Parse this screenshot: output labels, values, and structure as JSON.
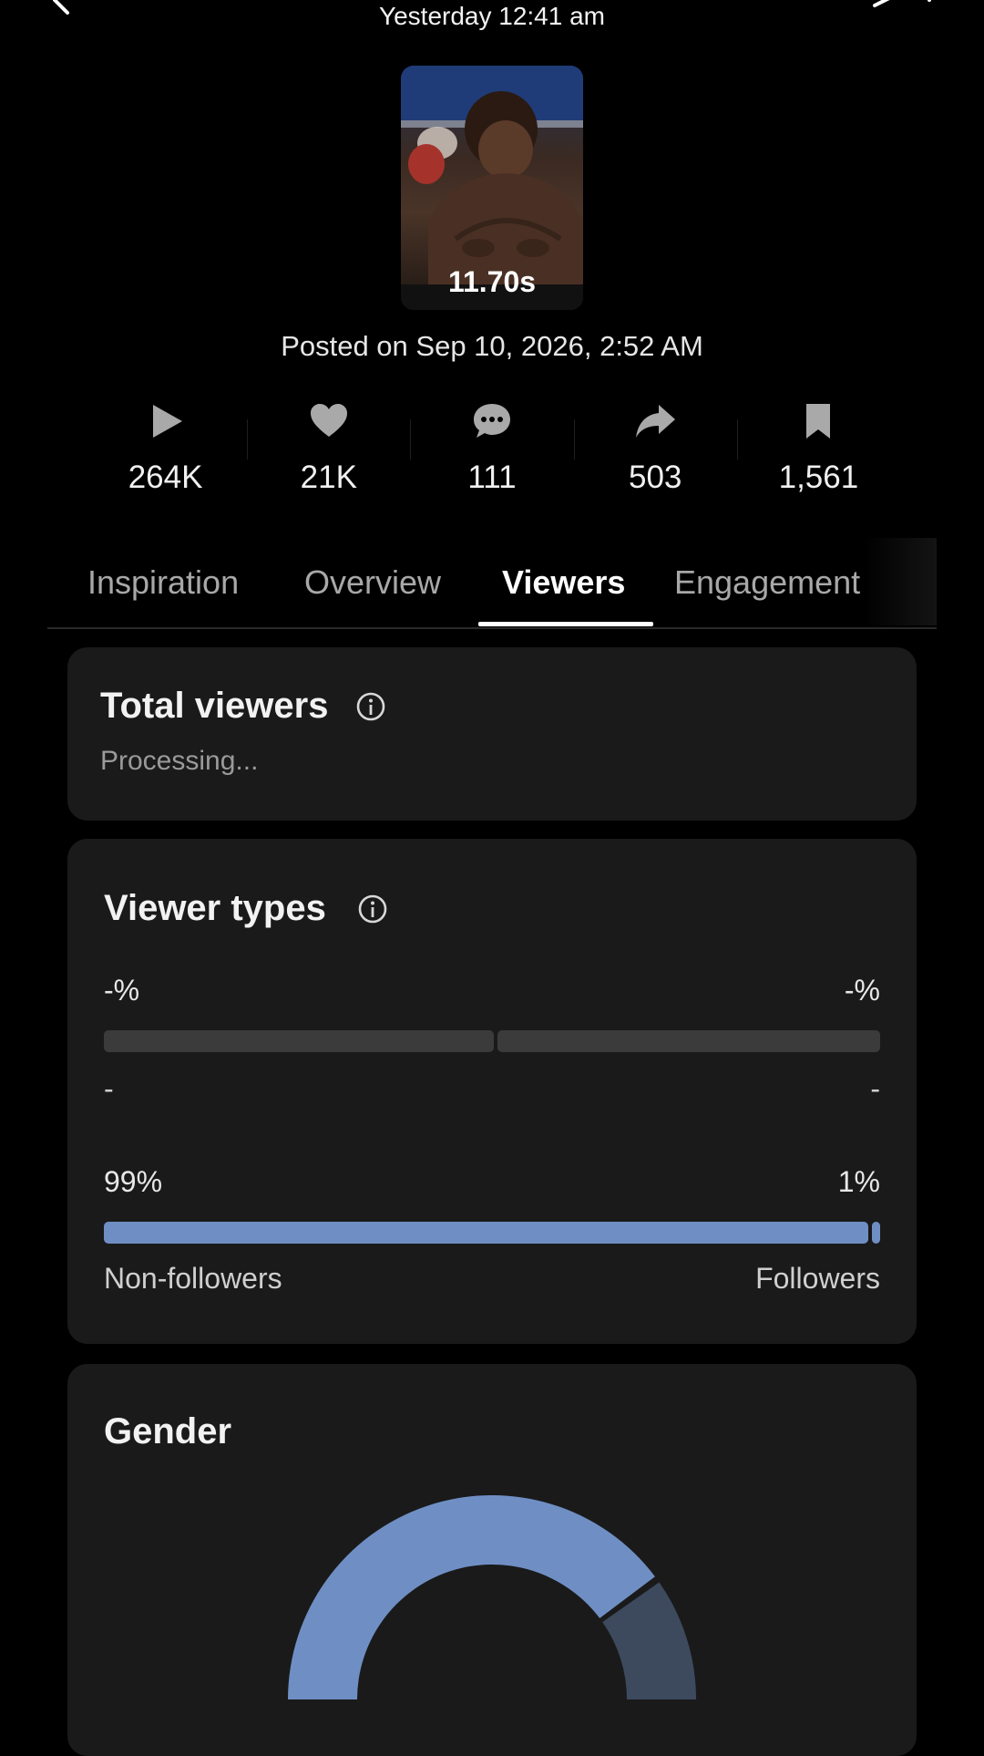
{
  "header": {
    "time": "Yesterday 12:41 am"
  },
  "video": {
    "duration": "11.70s",
    "posted": "Posted on Sep 10, 2026, 2:52 AM"
  },
  "stats": [
    {
      "icon": "play-icon",
      "value": "264K"
    },
    {
      "icon": "heart-icon",
      "value": "21K"
    },
    {
      "icon": "comment-icon",
      "value": "111"
    },
    {
      "icon": "share-icon",
      "value": "503"
    },
    {
      "icon": "bookmark-icon",
      "value": "1,561"
    }
  ],
  "tabs": [
    {
      "label": "Inspiration"
    },
    {
      "label": "Overview"
    },
    {
      "label": "Viewers",
      "active": true
    },
    {
      "label": "Engagement"
    }
  ],
  "total_viewers": {
    "title": "Total viewers",
    "value": "Processing..."
  },
  "viewer_types": {
    "title": "Viewer types",
    "row1": {
      "left_pct": "-%",
      "right_pct": "-%",
      "left_label": "-",
      "right_label": "-"
    },
    "row2": {
      "left_pct": "99%",
      "right_pct": "1%",
      "left_label": "Non-followers",
      "right_label": "Followers",
      "fill_fraction": 0.99
    }
  },
  "gender": {
    "title": "Gender",
    "primary_fraction": 0.8
  },
  "colors": {
    "accent_blue": "#6f8fc4",
    "dark_segment": "#3d4a5e",
    "card_bg": "#1a1a1b"
  }
}
